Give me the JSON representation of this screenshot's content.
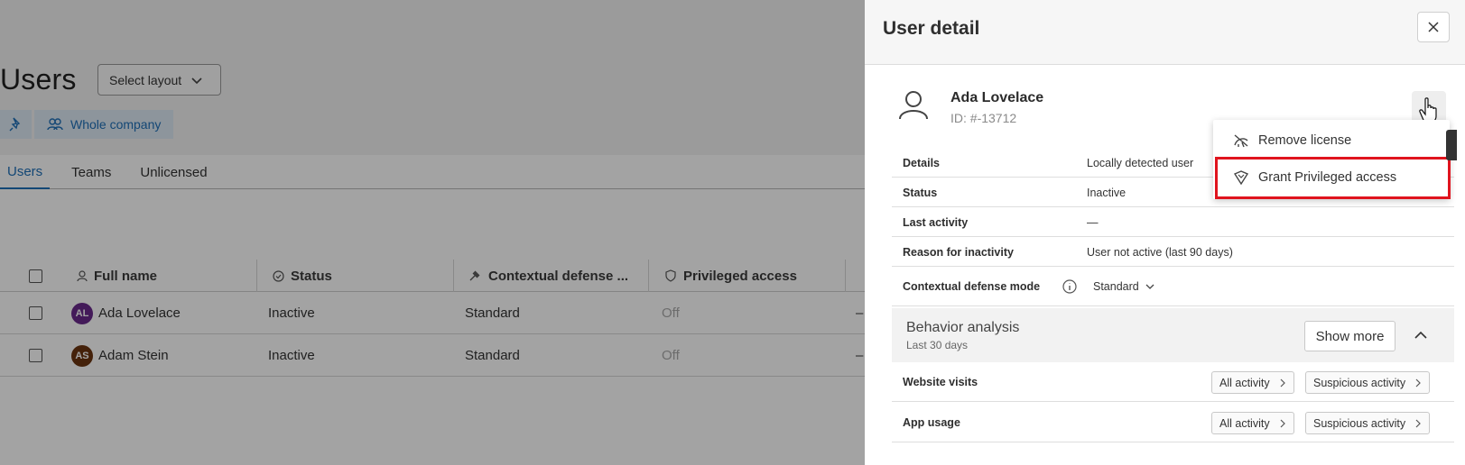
{
  "page": {
    "title": "Users",
    "select_layout": "Select layout",
    "filter_label": "Whole company",
    "tabs": [
      "Users",
      "Teams",
      "Unlicensed"
    ],
    "table": {
      "headers": [
        "Full name",
        "Status",
        "Contextual defense ...",
        "Privileged access"
      ],
      "rows": [
        {
          "initials": "AL",
          "avatar_color": "#6a2a8c",
          "name": "Ada Lovelace",
          "status": "Inactive",
          "mode": "Standard",
          "privileged": "Off",
          "extra": "–"
        },
        {
          "initials": "AS",
          "avatar_color": "#6b3410",
          "name": "Adam Stein",
          "status": "Inactive",
          "mode": "Standard",
          "privileged": "Off",
          "extra": "–"
        }
      ]
    }
  },
  "panel": {
    "title": "User detail",
    "user": {
      "name": "Ada Lovelace",
      "id": "ID: #-13712"
    },
    "details": [
      {
        "label": "Details",
        "value": "Locally detected user"
      },
      {
        "label": "Status",
        "value": "Inactive"
      },
      {
        "label": "Last activity",
        "value": "—"
      },
      {
        "label": "Reason for inactivity",
        "value": "User not active (last 90 days)"
      }
    ],
    "mode": {
      "label": "Contextual defense mode",
      "value": "Standard"
    },
    "behavior": {
      "title": "Behavior analysis",
      "subtitle": "Last 30 days",
      "show_more": "Show more"
    },
    "activities": [
      {
        "label": "Website visits",
        "all": "All activity",
        "suspicious": "Suspicious activity"
      },
      {
        "label": "App usage",
        "all": "All activity",
        "suspicious": "Suspicious activity"
      }
    ]
  },
  "menu": {
    "items": [
      {
        "label": "Remove license",
        "icon": "remove-license-icon"
      },
      {
        "label": "Grant Privileged access",
        "icon": "privileged-shield-icon"
      }
    ],
    "highlight_color": "#e0141e"
  },
  "colors": {
    "accent": "#1f6fb8",
    "overlay": "rgba(0,0,0,0.36)"
  }
}
